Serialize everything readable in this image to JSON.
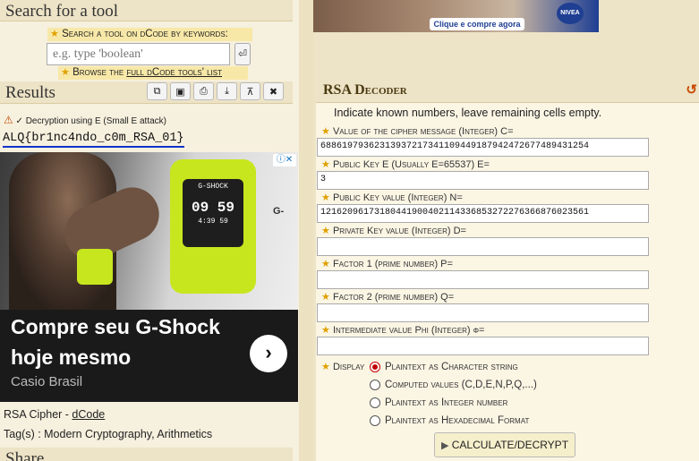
{
  "left": {
    "search_title": "Search for a tool",
    "keywords_label": "Search a tool on dCode by keywords:",
    "search_placeholder": "e.g. type 'boolean'",
    "search_go": "⏎",
    "browse_prefix": "Browse the ",
    "browse_link": "full dCode tools' list",
    "results_title": "Results",
    "toolbar": [
      {
        "name": "copy-button",
        "icon": "⧉"
      },
      {
        "name": "save-button",
        "icon": "▣"
      },
      {
        "name": "print-button",
        "icon": "⎙"
      },
      {
        "name": "download-button",
        "icon": "⤓"
      },
      {
        "name": "pin-button",
        "icon": "⊼"
      },
      {
        "name": "close-button",
        "icon": "✖"
      }
    ],
    "result_note": "✓ Decryption using E (Small E attack)",
    "result_value": "ALQ{br1nc4ndo_c0m_RSA_01}",
    "cipher_prefix": "RSA Cipher - ",
    "cipher_link": "dCode",
    "tags": "Tag(s) : Modern Cryptography, Arithmetics",
    "share_title": "Share"
  },
  "ad": {
    "headline": "Compre seu G-Shock hoje mesmo",
    "advertiser": "Casio Brasil",
    "watch_brand": "G-SHOCK",
    "watch_time": "09 59",
    "watch_small": "4:39 59",
    "side_text": "G-",
    "choices_icon": "ⓘ✕",
    "cta_icon": "›"
  },
  "banner": {
    "button": "Clique e compre agora",
    "logo": "NIVEA"
  },
  "decoder": {
    "title": "RSA Decoder",
    "refresh_icon": "↺",
    "instructions": "Indicate known numbers, leave remaining cells empty.",
    "fields": [
      {
        "label": "Value of the cipher message (Integer) C=",
        "value": "68861979362313937217341109449187942472677489431254"
      },
      {
        "label": "Public Key E (Usually E=65537) E=",
        "value": "3"
      },
      {
        "label": "Public Key value (Integer) N=",
        "value": "12162096173180441900402114336853272276366876023561"
      },
      {
        "label": "Private Key value (Integer) D=",
        "value": ""
      },
      {
        "label": "Factor 1 (prime number) P=",
        "value": ""
      },
      {
        "label": "Factor 2 (prime number) Q=",
        "value": ""
      },
      {
        "label": "Intermediate value Phi (Integer) φ=",
        "value": ""
      }
    ],
    "display_label": "Display",
    "options": [
      {
        "label": "Plaintext as Character string",
        "selected": true
      },
      {
        "label": "Computed values (C,D,E,N,P,Q,...)",
        "selected": false
      },
      {
        "label": "Plaintext as Integer number",
        "selected": false
      },
      {
        "label": "Plaintext as Hexadecimal Format",
        "selected": false
      }
    ],
    "calculate": "CALCULATE/DECRYPT"
  }
}
